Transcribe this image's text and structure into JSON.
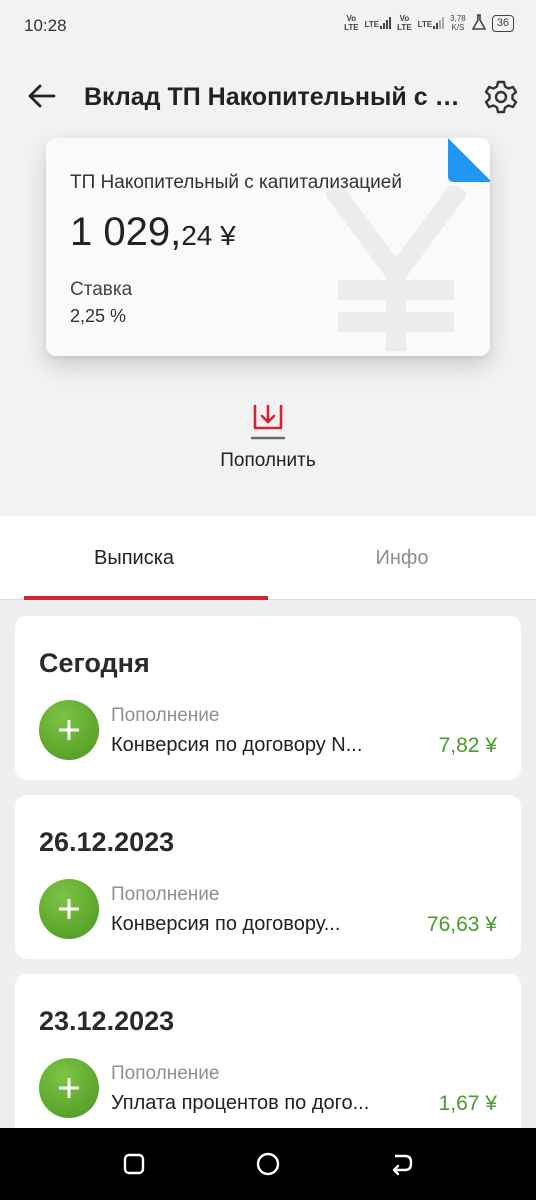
{
  "status_bar": {
    "time": "10:28",
    "sim1_top": "Vo",
    "sim1_bottom": "LTE",
    "sim1_net": "LTE",
    "sim2_top": "Vo",
    "sim2_bottom": "LTE",
    "sim2_net": "LTE",
    "speed_value": "3,78",
    "speed_unit": "K/S",
    "battery": "36"
  },
  "header": {
    "title": "Вклад ТП Накопительный с капитализацией"
  },
  "card": {
    "name": "ТП Накопительный с капитализацией",
    "balance_int": "1 029,",
    "balance_frac": "24 ¥",
    "rate_label": "Ставка",
    "rate_value": "2,25 %",
    "watermark_symbol": "¥",
    "corner_color": "#2196f3"
  },
  "actions": {
    "topup_label": "Пополнить"
  },
  "tabs": {
    "statement": "Выписка",
    "info": "Инфо",
    "active": "statement",
    "accent_color": "#d5232f"
  },
  "groups": [
    {
      "date": "Сегодня",
      "operations": [
        {
          "type": "Пополнение",
          "description": "Конверсия по договору N...",
          "amount": "7,82 ¥"
        }
      ]
    },
    {
      "date": "26.12.2023",
      "operations": [
        {
          "type": "Пополнение",
          "description": "Конверсия по договору...",
          "amount": "76,63 ¥"
        }
      ]
    },
    {
      "date": "23.12.2023",
      "operations": [
        {
          "type": "Пополнение",
          "description": "Уплата процентов по дого...",
          "amount": "1,67 ¥"
        }
      ]
    }
  ],
  "colors": {
    "income_green": "#4a9a2a",
    "icon_green": "#5ea92e"
  }
}
